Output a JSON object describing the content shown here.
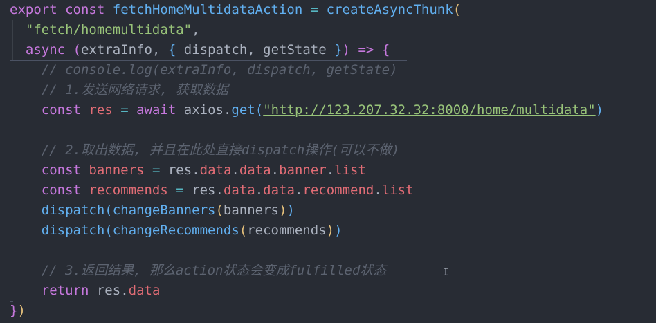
{
  "lines": [
    {
      "segments": [
        [
          "kw",
          "export"
        ],
        [
          "plain",
          " "
        ],
        [
          "kw",
          "const"
        ],
        [
          "plain",
          " "
        ],
        [
          "fn",
          "fetchHomeMultidataAction"
        ],
        [
          "plain",
          " "
        ],
        [
          "op",
          "="
        ],
        [
          "plain",
          " "
        ],
        [
          "fn",
          "createAsyncThunk"
        ],
        [
          "brace-y",
          "("
        ]
      ]
    },
    {
      "segments": [
        [
          "plain",
          "  "
        ],
        [
          "str",
          "\"fetch/homemultidata\""
        ],
        [
          "plain",
          ","
        ]
      ]
    },
    {
      "segments": [
        [
          "plain",
          "  "
        ],
        [
          "kw",
          "async"
        ],
        [
          "plain",
          " "
        ],
        [
          "brace-p",
          "("
        ],
        [
          "param",
          "extraInfo"
        ],
        [
          "plain",
          ", "
        ],
        [
          "brace-b",
          "{"
        ],
        [
          "plain",
          " "
        ],
        [
          "param",
          "dispatch"
        ],
        [
          "plain",
          ", "
        ],
        [
          "param",
          "getState"
        ],
        [
          "plain",
          " "
        ],
        [
          "brace-b",
          "}"
        ],
        [
          "brace-p",
          ")"
        ],
        [
          "plain",
          " "
        ],
        [
          "kw",
          "=>"
        ],
        [
          "plain",
          " "
        ],
        [
          "brace-p",
          "{"
        ]
      ]
    },
    {
      "segments": [
        [
          "plain",
          "    "
        ],
        [
          "comment",
          "// console.log(extraInfo, dispatch, getState)"
        ]
      ]
    },
    {
      "segments": [
        [
          "plain",
          "    "
        ],
        [
          "comment",
          "// 1.发送网络请求, 获取数据"
        ]
      ]
    },
    {
      "segments": [
        [
          "plain",
          "    "
        ],
        [
          "kw",
          "const"
        ],
        [
          "plain",
          " "
        ],
        [
          "var",
          "res"
        ],
        [
          "plain",
          " "
        ],
        [
          "op",
          "="
        ],
        [
          "plain",
          " "
        ],
        [
          "kw",
          "await"
        ],
        [
          "plain",
          " "
        ],
        [
          "plain",
          "axios"
        ],
        [
          "dot",
          "."
        ],
        [
          "fn",
          "get"
        ],
        [
          "brace-b",
          "("
        ],
        [
          "str",
          "\"http://123.207.32.32:8000/home/multidata\""
        ],
        [
          "brace-b",
          ")"
        ]
      ]
    },
    {
      "segments": [
        [
          "plain",
          ""
        ]
      ]
    },
    {
      "segments": [
        [
          "plain",
          "    "
        ],
        [
          "comment",
          "// 2.取出数据, 并且在此处直接dispatch操作(可以不做)"
        ]
      ]
    },
    {
      "segments": [
        [
          "plain",
          "    "
        ],
        [
          "kw",
          "const"
        ],
        [
          "plain",
          " "
        ],
        [
          "var",
          "banners"
        ],
        [
          "plain",
          " "
        ],
        [
          "op",
          "="
        ],
        [
          "plain",
          " "
        ],
        [
          "plain",
          "res"
        ],
        [
          "dot",
          "."
        ],
        [
          "prop",
          "data"
        ],
        [
          "dot",
          "."
        ],
        [
          "prop",
          "data"
        ],
        [
          "dot",
          "."
        ],
        [
          "prop",
          "banner"
        ],
        [
          "dot",
          "."
        ],
        [
          "prop",
          "list"
        ]
      ]
    },
    {
      "segments": [
        [
          "plain",
          "    "
        ],
        [
          "kw",
          "const"
        ],
        [
          "plain",
          " "
        ],
        [
          "var",
          "recommends"
        ],
        [
          "plain",
          " "
        ],
        [
          "op",
          "="
        ],
        [
          "plain",
          " "
        ],
        [
          "plain",
          "res"
        ],
        [
          "dot",
          "."
        ],
        [
          "prop",
          "data"
        ],
        [
          "dot",
          "."
        ],
        [
          "prop",
          "data"
        ],
        [
          "dot",
          "."
        ],
        [
          "prop",
          "recommend"
        ],
        [
          "dot",
          "."
        ],
        [
          "prop",
          "list"
        ]
      ]
    },
    {
      "segments": [
        [
          "plain",
          "    "
        ],
        [
          "fn",
          "dispatch"
        ],
        [
          "brace-b",
          "("
        ],
        [
          "fn",
          "changeBanners"
        ],
        [
          "brace-y",
          "("
        ],
        [
          "plain",
          "banners"
        ],
        [
          "brace-y",
          ")"
        ],
        [
          "brace-b",
          ")"
        ]
      ]
    },
    {
      "segments": [
        [
          "plain",
          "    "
        ],
        [
          "fn",
          "dispatch"
        ],
        [
          "brace-b",
          "("
        ],
        [
          "fn",
          "changeRecommends"
        ],
        [
          "brace-y",
          "("
        ],
        [
          "plain",
          "recommends"
        ],
        [
          "brace-y",
          ")"
        ],
        [
          "brace-b",
          ")"
        ]
      ]
    },
    {
      "segments": [
        [
          "plain",
          ""
        ]
      ]
    },
    {
      "segments": [
        [
          "plain",
          "    "
        ],
        [
          "comment",
          "// 3.返回结果, 那么action状态会变成fulfilled状态"
        ]
      ]
    },
    {
      "segments": [
        [
          "plain",
          "    "
        ],
        [
          "kw",
          "return"
        ],
        [
          "plain",
          " "
        ],
        [
          "plain",
          "res"
        ],
        [
          "dot",
          "."
        ],
        [
          "prop",
          "data"
        ]
      ]
    },
    {
      "segments": [
        [
          "brace-p",
          "}"
        ],
        [
          "brace-y",
          ")"
        ]
      ]
    }
  ],
  "cursor_glyph": "I"
}
